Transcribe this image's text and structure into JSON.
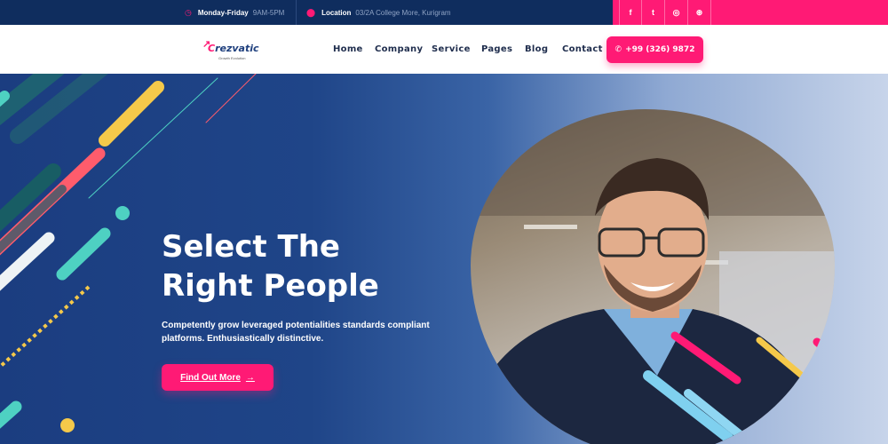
{
  "topbar": {
    "hours_label": "Monday-Friday",
    "hours_value": "9AM-5PM",
    "location_label": "Location",
    "location_value": "03/2A College More, Kurigram",
    "social": [
      {
        "icon": "facebook-icon",
        "glyph": "f"
      },
      {
        "icon": "twitter-icon",
        "glyph": "t"
      },
      {
        "icon": "instagram-icon",
        "glyph": "◎"
      },
      {
        "icon": "dribbble-icon",
        "glyph": "⊛"
      }
    ]
  },
  "nav": {
    "logo_text_c": "C",
    "logo_text_rest": "rezvatic",
    "logo_tagline": "Growth Evolution",
    "items": [
      "Home",
      "Company",
      "Service",
      "Pages",
      "Blog",
      "Contact"
    ],
    "phone": "+99 (326) 9872"
  },
  "hero": {
    "title_line1": "Select The",
    "title_line2": "Right People",
    "description": "Competently grow leveraged potentialities standards compliant platforms. Enthusiastically distinctive.",
    "cta_label": "Find Out More",
    "cta_arrow": "→"
  },
  "colors": {
    "accent": "#ff1a75",
    "navy": "#0f2d5e",
    "hero_blue": "#1e3f7d"
  }
}
